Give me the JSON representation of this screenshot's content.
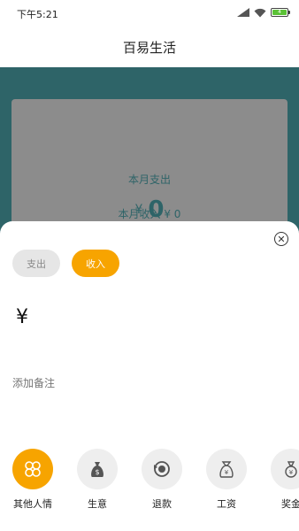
{
  "status": {
    "time": "下午5:21",
    "battery": "4"
  },
  "header": {
    "title": "百易生活"
  },
  "summary": {
    "month_expense_label": "本月支出",
    "currency": "¥",
    "month_expense_value": "0",
    "month_income_text": "本月收入 ¥ 0"
  },
  "sheet": {
    "close_icon": "close-icon",
    "tabs": [
      {
        "label": "支出",
        "selected": false
      },
      {
        "label": "收入",
        "selected": true
      }
    ],
    "amount": "¥",
    "note_placeholder": "添加备注",
    "categories": [
      {
        "label": "其他人情",
        "icon": "four-petal-icon",
        "active": true
      },
      {
        "label": "生意",
        "icon": "money-bag-icon",
        "active": false
      },
      {
        "label": "退款",
        "icon": "refund-icon",
        "active": false
      },
      {
        "label": "工资",
        "icon": "salary-bag-icon",
        "active": false
      },
      {
        "label": "奖金",
        "icon": "bonus-bag-icon",
        "active": false
      }
    ]
  },
  "colors": {
    "accent": "#f7a400",
    "overlay": "#2e6468",
    "card": "#8c8c8c"
  }
}
